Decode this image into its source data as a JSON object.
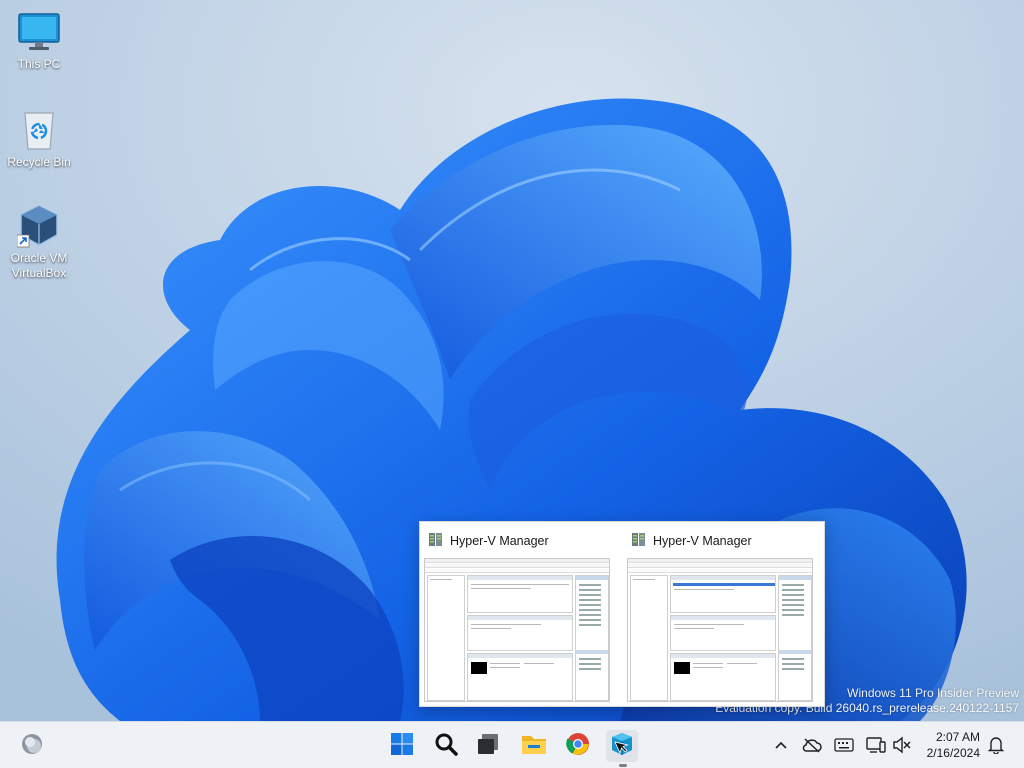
{
  "desktop": {
    "icons": [
      {
        "label": "This PC",
        "icon": "monitor-icon"
      },
      {
        "label": "Recycle Bin",
        "icon": "recycle-bin-icon"
      },
      {
        "label": "Oracle VM\nVirtualBox",
        "icon": "virtualbox-icon"
      }
    ]
  },
  "watermark": {
    "line1": "Windows 11 Pro Insider Preview",
    "line2": "Evaluation copy. Build 26040.rs_prerelease.240122-1157"
  },
  "thumbnails": [
    {
      "title": "Hyper-V Manager",
      "icon": "hyper-v-icon"
    },
    {
      "title": "Hyper-V Manager",
      "icon": "hyper-v-icon"
    }
  ],
  "taskbar": {
    "widgets_icon": "weather-icon",
    "apps": [
      {
        "name": "Start",
        "icon": "windows-start-icon"
      },
      {
        "name": "Search",
        "icon": "search-icon"
      },
      {
        "name": "Task View",
        "icon": "task-view-icon"
      },
      {
        "name": "File Explorer",
        "icon": "folder-icon"
      },
      {
        "name": "Google Chrome",
        "icon": "chrome-icon"
      },
      {
        "name": "Hyper-V Manager",
        "icon": "hyper-v-icon",
        "active": true
      }
    ],
    "tray_icons": [
      "chevron-up-icon",
      "cloud-offline-icon",
      "keyboard-icon",
      "device-icon",
      "speaker-muted-icon",
      "notification-bell-icon"
    ],
    "clock": {
      "time": "2:07 AM",
      "date": "2/16/2024"
    }
  },
  "colors": {
    "accent": "#1a6ee8",
    "taskbar": "#eef1f5",
    "wallpaper": "#c7d7e6"
  }
}
